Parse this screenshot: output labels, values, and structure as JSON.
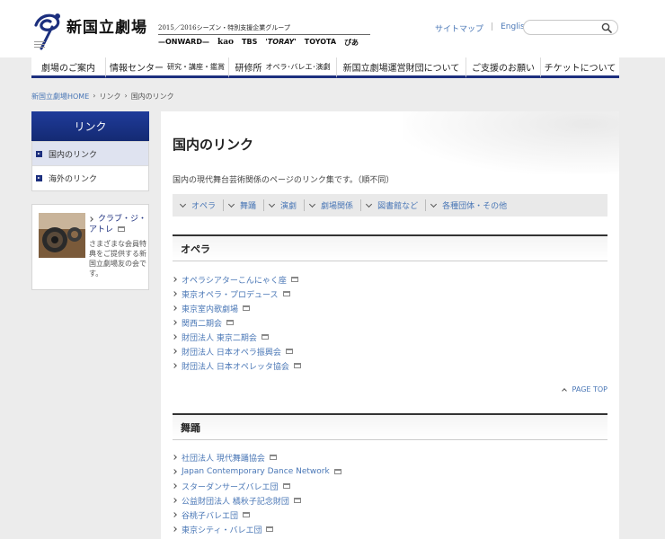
{
  "header": {
    "logo_title": "新国立劇場",
    "sponsor_line": "2015／2016シーズン・特別支援企業グループ",
    "sponsors": [
      "—ONWARD—",
      "kao",
      "TBS",
      "'TORAY'",
      "TOYOTA",
      "ぴあ"
    ],
    "top_links": {
      "sitemap": "サイトマップ",
      "separator": "|",
      "english": "English"
    },
    "search": {
      "value": "",
      "placeholder": ""
    }
  },
  "nav": {
    "items": [
      {
        "label": "劇場のご案内",
        "sub": ""
      },
      {
        "label": "情報センター",
        "sub": "研究・講座・鑑賞"
      },
      {
        "label": "研修所",
        "sub": "オペラ･バレエ･演劇"
      },
      {
        "label": "新国立劇場運営財団について",
        "sub": ""
      },
      {
        "label": "ご支援のお願い",
        "sub": ""
      },
      {
        "label": "チケットについて",
        "sub": ""
      }
    ]
  },
  "breadcrumb": {
    "home": "新国立劇場HOME",
    "sep1": "›",
    "links": "リンク",
    "sep2": "›",
    "current": "国内のリンク"
  },
  "sidebar": {
    "heading": "リンク",
    "items": [
      {
        "label": "国内のリンク",
        "active": true
      },
      {
        "label": "海外のリンク",
        "active": false
      }
    ],
    "club": {
      "title": "クラブ・ジ・アトレ",
      "description": "さまざまな会員特典をご提供する新国立劇場友の会です。"
    }
  },
  "main": {
    "title": "国内のリンク",
    "intro": "国内の現代舞台芸術関係のページのリンク集です。（順不同）",
    "anchors": [
      "オペラ",
      "舞踊",
      "演劇",
      "劇場関係",
      "図書館など",
      "各種団体・その他"
    ],
    "sections": [
      {
        "heading": "オペラ",
        "links": [
          "オペラシアターこんにゃく座",
          "東京オペラ・プロデュース",
          "東京室内歌劇場",
          "関西二期会",
          "財団法人 東京二期会",
          "財団法人 日本オペラ振興会",
          "財団法人 日本オペレッタ協会"
        ]
      },
      {
        "heading": "舞踊",
        "links": [
          "社団法人 現代舞踊協会",
          "Japan Contemporary Dance Network",
          "スターダンサーズバレエ団",
          "公益財団法人 橘秋子記念財団",
          "谷桃子バレエ団",
          "東京シティ・バレエ団"
        ]
      }
    ],
    "pagetop": "PAGE TOP"
  },
  "colors": {
    "navy": "#1c2f7e",
    "link": "#4a77b6",
    "background": "#ececec"
  }
}
